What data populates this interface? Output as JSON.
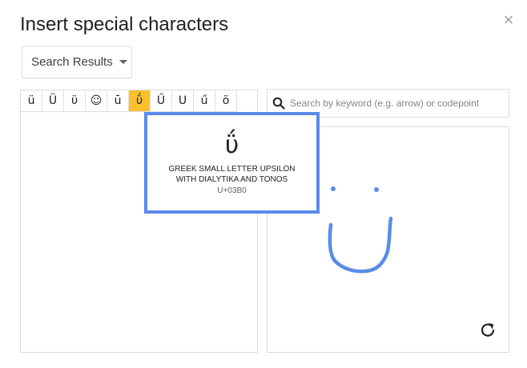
{
  "dialog": {
    "title": "Insert special characters",
    "close_label": "×"
  },
  "category": {
    "selected": "Search Results"
  },
  "results": {
    "characters": [
      "ü",
      "Ü",
      "ϋ",
      "☺",
      "ū",
      "ΰ",
      "Ű",
      "U",
      "ű",
      "ö"
    ],
    "selected_index": 5
  },
  "search": {
    "placeholder": "Search by keyword (e.g. arrow) or codepoint",
    "value": ""
  },
  "tooltip": {
    "char": "ΰ",
    "name": "GREEK SMALL LETTER UPSILON WITH DIALYTIKA AND TONOS",
    "codepoint": "U+03B0"
  },
  "colors": {
    "accent": "#5b8bea",
    "selected_cell": "#fbc02d",
    "drawing_stroke": "#5b8bea"
  },
  "icons": {
    "search": "search-icon",
    "reset": "reset-icon",
    "close": "close-icon",
    "dropdown": "chevron-down-icon"
  }
}
